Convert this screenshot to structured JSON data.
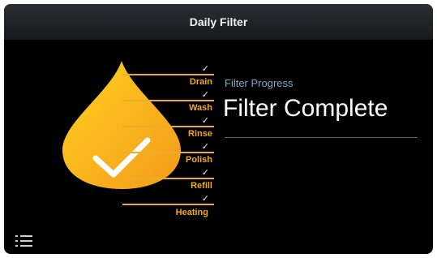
{
  "header": {
    "title": "Daily Filter"
  },
  "progress": {
    "caption": "Filter Progress",
    "status": "Filter Complete"
  },
  "steps": [
    {
      "label": "",
      "check": "✓"
    },
    {
      "label": "Drain",
      "check": "✓"
    },
    {
      "label": "Wash",
      "check": "✓"
    },
    {
      "label": "Rinse",
      "check": "✓"
    },
    {
      "label": "Polish",
      "check": "✓"
    },
    {
      "label": "Refill",
      "check": "✓"
    },
    {
      "label": "Heating",
      "check": ""
    }
  ],
  "icons": {
    "drop": "water-drop-icon",
    "check": "checkmark-icon",
    "menu": "list-menu-icon"
  },
  "colors": {
    "accent": "#f2a91e",
    "drop_top": "#ffd21f",
    "drop_bottom": "#f39a1c",
    "caption": "#7fa9c7",
    "background": "#000000"
  }
}
